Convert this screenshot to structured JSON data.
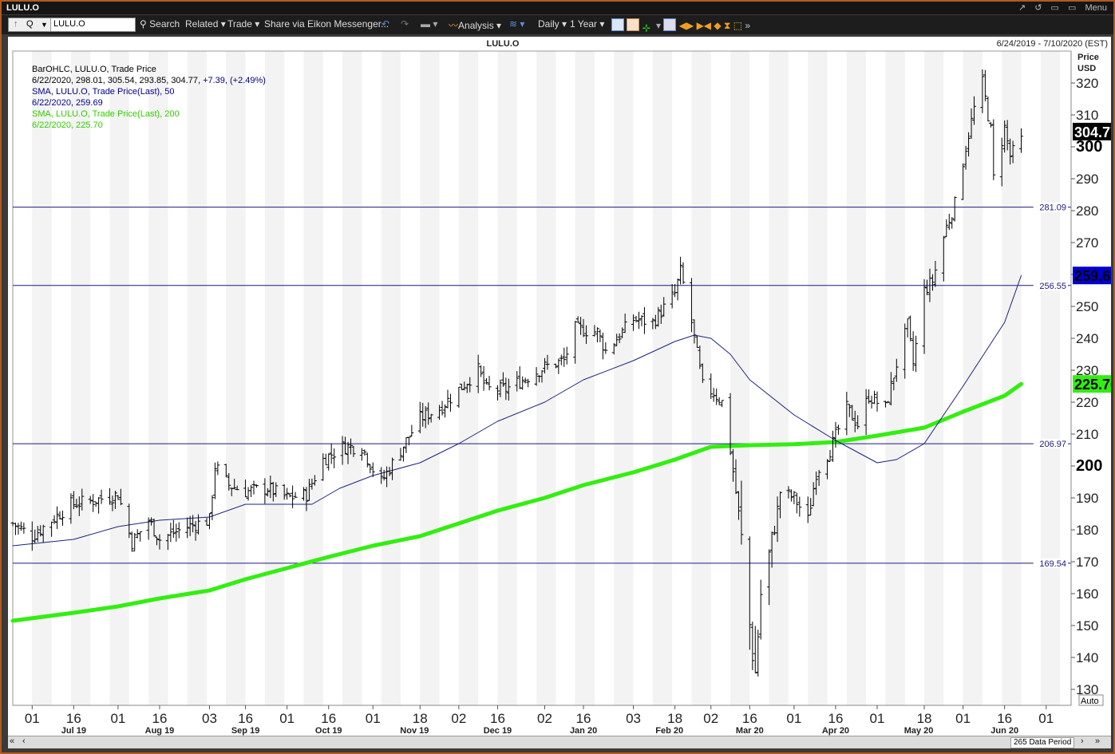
{
  "window": {
    "title": "LULU.O",
    "menu_label": "Menu",
    "controls": [
      "↗",
      "↺",
      "▭"
    ]
  },
  "toolbar": {
    "quote_mode": "Q",
    "ric_value": "LULU.O",
    "search": "Search",
    "related": "Related",
    "trade": "Trade",
    "share": "Share via Eikon Messenger...",
    "analysis": "Analysis",
    "interval": "Daily",
    "period": "1 Year"
  },
  "chart": {
    "title": "LULU.O",
    "date_range": "6/24/2019 - 7/10/2020 (EST)",
    "axis_title": "Price",
    "axis_currency": "USD",
    "auto_label": "Auto",
    "data_period": "265 Data Period",
    "legend": [
      {
        "text": "BarOHLC, LULU.O, Trade Price",
        "color": "#000000"
      },
      {
        "text": "6/22/2020, 298.01, 305.54, 293.85, 304.77, ",
        "color": "#000000",
        "extra": "+7.39, (+2.49%)",
        "extra_color": "#000080"
      },
      {
        "text": "SMA, LULU.O, Trade Price(Last),  50",
        "color": "#00008b"
      },
      {
        "text": "6/22/2020, 259.69",
        "color": "#00008b"
      },
      {
        "text": "SMA, LULU.O, Trade Price(Last),  200",
        "color": "#33cc00"
      },
      {
        "text": "6/22/2020, 225.70",
        "color": "#33cc00"
      }
    ],
    "colors": {
      "sma50": "#1a237e",
      "sma200": "#33ee11",
      "bars": "#000000",
      "hline": "#1a1a80"
    },
    "price_badges": [
      {
        "value": 304.77,
        "label": "304.77",
        "bg": "#000000",
        "fg": "#ffffff"
      },
      {
        "value": 259.69,
        "label": "259.69",
        "bg": "#0000cc",
        "fg": "#000000"
      },
      {
        "value": 225.7,
        "label": "225.70",
        "bg": "#33ee11",
        "fg": "#000000"
      }
    ]
  },
  "chart_data": {
    "type": "line",
    "title": "LULU.O",
    "ylabel": "Price USD",
    "ylim": [
      125,
      330
    ],
    "y_ticks": [
      130,
      140,
      150,
      160,
      170,
      180,
      190,
      200,
      210,
      220,
      230,
      240,
      250,
      260,
      270,
      280,
      290,
      300,
      310,
      320
    ],
    "y_tick_bold": [
      200,
      300
    ],
    "x_range": [
      "2019-06-24",
      "2020-07-10"
    ],
    "x_ticks": [
      {
        "date": "2019-07-01",
        "label": "01"
      },
      {
        "date": "2019-07-16",
        "label": "16"
      },
      {
        "date": "2019-08-01",
        "label": "01"
      },
      {
        "date": "2019-08-16",
        "label": "16"
      },
      {
        "date": "2019-09-03",
        "label": "03"
      },
      {
        "date": "2019-09-16",
        "label": "16"
      },
      {
        "date": "2019-10-01",
        "label": "01"
      },
      {
        "date": "2019-10-16",
        "label": "16"
      },
      {
        "date": "2019-11-01",
        "label": "01"
      },
      {
        "date": "2019-11-18",
        "label": "18"
      },
      {
        "date": "2019-12-02",
        "label": "02"
      },
      {
        "date": "2019-12-16",
        "label": "16"
      },
      {
        "date": "2020-01-02",
        "label": "02"
      },
      {
        "date": "2020-01-16",
        "label": "16"
      },
      {
        "date": "2020-02-03",
        "label": "03"
      },
      {
        "date": "2020-02-18",
        "label": "18"
      },
      {
        "date": "2020-03-02",
        "label": "02"
      },
      {
        "date": "2020-03-16",
        "label": "16"
      },
      {
        "date": "2020-04-01",
        "label": "01"
      },
      {
        "date": "2020-04-16",
        "label": "16"
      },
      {
        "date": "2020-05-01",
        "label": "01"
      },
      {
        "date": "2020-05-18",
        "label": "18"
      },
      {
        "date": "2020-06-01",
        "label": "01"
      },
      {
        "date": "2020-06-16",
        "label": "16"
      },
      {
        "date": "2020-07-01",
        "label": "01"
      }
    ],
    "month_labels": [
      {
        "date": "2019-07-16",
        "label": "Jul 19"
      },
      {
        "date": "2019-08-16",
        "label": "Aug 19"
      },
      {
        "date": "2019-09-16",
        "label": "Sep 19"
      },
      {
        "date": "2019-10-16",
        "label": "Oct 19"
      },
      {
        "date": "2019-11-16",
        "label": "Nov 19"
      },
      {
        "date": "2019-12-16",
        "label": "Dec 19"
      },
      {
        "date": "2020-01-16",
        "label": "Jan 20"
      },
      {
        "date": "2020-02-16",
        "label": "Feb 20"
      },
      {
        "date": "2020-03-16",
        "label": "Mar 20"
      },
      {
        "date": "2020-04-16",
        "label": "Apr 20"
      },
      {
        "date": "2020-05-16",
        "label": "May 20"
      },
      {
        "date": "2020-06-16",
        "label": "Jun 20"
      }
    ],
    "hlines": [
      {
        "value": 281.09,
        "label": "281.09"
      },
      {
        "value": 256.55,
        "label": "256.55"
      },
      {
        "value": 206.97,
        "label": "206.97"
      },
      {
        "value": 169.54,
        "label": "169.54"
      }
    ],
    "price_path": [
      [
        "2019-06-24",
        182
      ],
      [
        "2019-07-01",
        178
      ],
      [
        "2019-07-08",
        183
      ],
      [
        "2019-07-15",
        188
      ],
      [
        "2019-07-22",
        189
      ],
      [
        "2019-08-01",
        191
      ],
      [
        "2019-08-06",
        176
      ],
      [
        "2019-08-12",
        183
      ],
      [
        "2019-08-16",
        177
      ],
      [
        "2019-08-26",
        181
      ],
      [
        "2019-09-03",
        183
      ],
      [
        "2019-09-05",
        200
      ],
      [
        "2019-09-10",
        194
      ],
      [
        "2019-09-16",
        192
      ],
      [
        "2019-09-24",
        193
      ],
      [
        "2019-10-01",
        190
      ],
      [
        "2019-10-08",
        191
      ],
      [
        "2019-10-14",
        202
      ],
      [
        "2019-10-21",
        206
      ],
      [
        "2019-10-28",
        206
      ],
      [
        "2019-11-01",
        199
      ],
      [
        "2019-11-04",
        195
      ],
      [
        "2019-11-11",
        205
      ],
      [
        "2019-11-18",
        215
      ],
      [
        "2019-11-25",
        218
      ],
      [
        "2019-12-02",
        224
      ],
      [
        "2019-12-09",
        230
      ],
      [
        "2019-12-12",
        224
      ],
      [
        "2019-12-19",
        224
      ],
      [
        "2020-01-02",
        231
      ],
      [
        "2020-01-09",
        233
      ],
      [
        "2020-01-13",
        243
      ],
      [
        "2020-01-21",
        242
      ],
      [
        "2020-01-24",
        236
      ],
      [
        "2020-02-03",
        246
      ],
      [
        "2020-02-10",
        245
      ],
      [
        "2020-02-18",
        254
      ],
      [
        "2020-02-20",
        261
      ],
      [
        "2020-02-24",
        245
      ],
      [
        "2020-02-28",
        225
      ],
      [
        "2020-03-03",
        223
      ],
      [
        "2020-03-06",
        220
      ],
      [
        "2020-03-09",
        205
      ],
      [
        "2020-03-12",
        185
      ],
      [
        "2020-03-16",
        150
      ],
      [
        "2020-03-18",
        135
      ],
      [
        "2020-03-20",
        160
      ],
      [
        "2020-03-24",
        175
      ],
      [
        "2020-03-27",
        192
      ],
      [
        "2020-04-01",
        190
      ],
      [
        "2020-04-06",
        183
      ],
      [
        "2020-04-09",
        198
      ],
      [
        "2020-04-14",
        205
      ],
      [
        "2020-04-20",
        218
      ],
      [
        "2020-04-24",
        213
      ],
      [
        "2020-04-28",
        222
      ],
      [
        "2020-05-04",
        218
      ],
      [
        "2020-05-08",
        232
      ],
      [
        "2020-05-12",
        244
      ],
      [
        "2020-05-14",
        232
      ],
      [
        "2020-05-18",
        255
      ],
      [
        "2020-05-21",
        258
      ],
      [
        "2020-05-26",
        275
      ],
      [
        "2020-05-29",
        282
      ],
      [
        "2020-06-02",
        300
      ],
      [
        "2020-06-05",
        312
      ],
      [
        "2020-06-08",
        320
      ],
      [
        "2020-06-11",
        305
      ],
      [
        "2020-06-12",
        290
      ],
      [
        "2020-06-16",
        306
      ],
      [
        "2020-06-18",
        297
      ],
      [
        "2020-06-22",
        302
      ]
    ],
    "series": [
      {
        "name": "SMA, LULU.O, Trade Price(Last),  50",
        "color": "#1a237e",
        "width": 1,
        "points": [
          [
            "2019-06-24",
            175
          ],
          [
            "2019-07-16",
            177
          ],
          [
            "2019-08-01",
            181
          ],
          [
            "2019-08-16",
            183
          ],
          [
            "2019-09-03",
            184
          ],
          [
            "2019-09-16",
            188
          ],
          [
            "2019-10-01",
            188
          ],
          [
            "2019-10-10",
            188
          ],
          [
            "2019-10-20",
            193
          ],
          [
            "2019-11-01",
            197
          ],
          [
            "2019-11-18",
            201
          ],
          [
            "2019-12-02",
            207
          ],
          [
            "2019-12-16",
            214
          ],
          [
            "2020-01-02",
            220
          ],
          [
            "2020-01-16",
            227
          ],
          [
            "2020-02-03",
            233
          ],
          [
            "2020-02-18",
            239
          ],
          [
            "2020-02-25",
            241
          ],
          [
            "2020-03-02",
            240
          ],
          [
            "2020-03-09",
            235
          ],
          [
            "2020-03-16",
            227
          ],
          [
            "2020-04-01",
            216
          ],
          [
            "2020-04-16",
            208
          ],
          [
            "2020-05-01",
            201
          ],
          [
            "2020-05-08",
            202
          ],
          [
            "2020-05-18",
            207
          ],
          [
            "2020-06-01",
            225
          ],
          [
            "2020-06-16",
            245
          ],
          [
            "2020-06-22",
            259.69
          ]
        ]
      },
      {
        "name": "SMA, LULU.O, Trade Price(Last),  200",
        "color": "#33ee11",
        "width": 5,
        "points": [
          [
            "2019-06-24",
            151.5
          ],
          [
            "2019-07-16",
            154
          ],
          [
            "2019-08-01",
            156
          ],
          [
            "2019-08-16",
            158.5
          ],
          [
            "2019-09-03",
            161
          ],
          [
            "2019-09-16",
            164.5
          ],
          [
            "2019-10-01",
            168
          ],
          [
            "2019-10-16",
            171.5
          ],
          [
            "2019-11-01",
            175
          ],
          [
            "2019-11-18",
            178
          ],
          [
            "2019-12-02",
            182
          ],
          [
            "2019-12-16",
            186
          ],
          [
            "2020-01-02",
            190
          ],
          [
            "2020-01-16",
            194
          ],
          [
            "2020-02-03",
            198
          ],
          [
            "2020-02-18",
            202
          ],
          [
            "2020-03-02",
            206
          ],
          [
            "2020-03-16",
            206.5
          ],
          [
            "2020-04-01",
            206.8
          ],
          [
            "2020-04-16",
            207.5
          ],
          [
            "2020-05-01",
            209.5
          ],
          [
            "2020-05-18",
            212
          ],
          [
            "2020-06-01",
            217
          ],
          [
            "2020-06-16",
            222
          ],
          [
            "2020-06-22",
            225.7
          ]
        ]
      }
    ]
  }
}
